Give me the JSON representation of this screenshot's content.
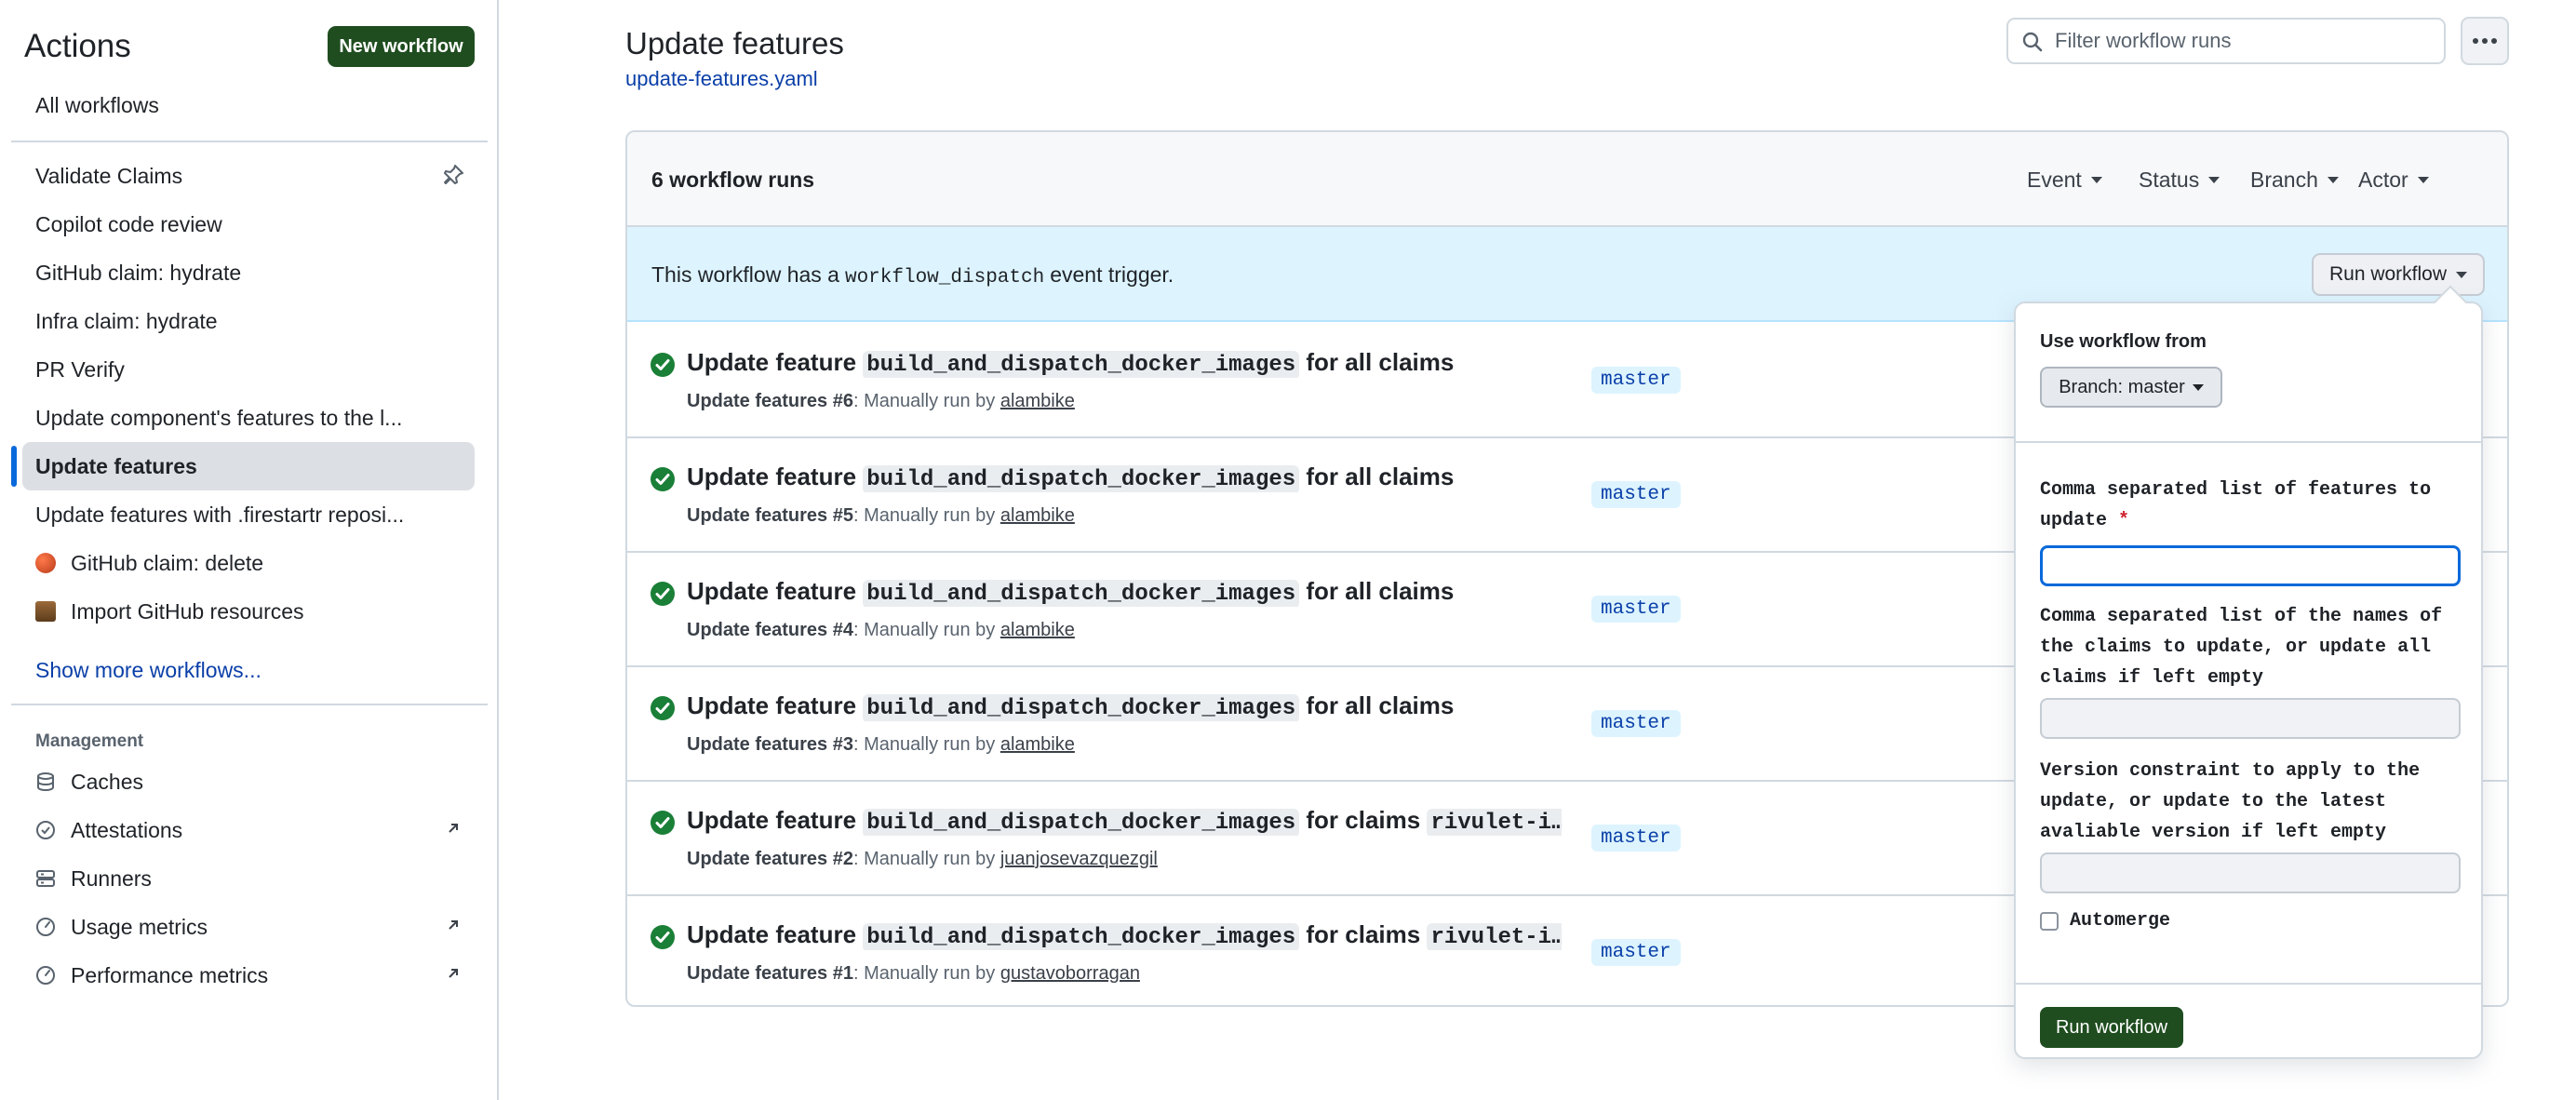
{
  "sidebar": {
    "title": "Actions",
    "new_workflow": "New workflow",
    "all_workflows": "All workflows",
    "workflows": [
      {
        "label": "Validate Claims",
        "pinned": true
      },
      {
        "label": "Copilot code review"
      },
      {
        "label": "GitHub claim: hydrate"
      },
      {
        "label": "Infra claim: hydrate"
      },
      {
        "label": "PR Verify"
      },
      {
        "label": "Update component's features to the l..."
      },
      {
        "label": "Update features",
        "active": true
      },
      {
        "label": "Update features with .firestartr reposi..."
      },
      {
        "label": "GitHub claim: delete",
        "icon": "red-ball-emoji-icon"
      },
      {
        "label": "Import GitHub resources",
        "icon": "scroll-emoji-icon"
      }
    ],
    "show_more": "Show more workflows...",
    "management_heading": "Management",
    "management": [
      {
        "label": "Caches",
        "icon": "database-icon"
      },
      {
        "label": "Attestations",
        "icon": "verified-icon",
        "external": true
      },
      {
        "label": "Runners",
        "icon": "server-icon"
      },
      {
        "label": "Usage metrics",
        "icon": "meter-icon",
        "external": true
      },
      {
        "label": "Performance metrics",
        "icon": "meter-icon",
        "external": true
      }
    ]
  },
  "header": {
    "title": "Update features",
    "file": "update-features.yaml",
    "filter_placeholder": "Filter workflow runs"
  },
  "runs": {
    "count_label": "6 workflow runs",
    "filters": [
      "Event",
      "Status",
      "Branch",
      "Actor"
    ],
    "dispatch": {
      "prefix": "This workflow has a",
      "code": "workflow_dispatch",
      "suffix": "event trigger.",
      "button": "Run workflow"
    },
    "items": [
      {
        "t1": "Update feature",
        "code": "build_and_dispatch_docker_images",
        "t2": "for all claims",
        "code2": "",
        "wf": "Update features",
        "num": "#6",
        "by": ": Manually run by",
        "actor": "alambike",
        "branch": "master"
      },
      {
        "t1": "Update feature",
        "code": "build_and_dispatch_docker_images",
        "t2": "for all claims",
        "code2": "",
        "wf": "Update features",
        "num": "#5",
        "by": ": Manually run by",
        "actor": "alambike",
        "branch": "master"
      },
      {
        "t1": "Update feature",
        "code": "build_and_dispatch_docker_images",
        "t2": "for all claims",
        "code2": "",
        "wf": "Update features",
        "num": "#4",
        "by": ": Manually run by",
        "actor": "alambike",
        "branch": "master"
      },
      {
        "t1": "Update feature",
        "code": "build_and_dispatch_docker_images",
        "t2": "for all claims",
        "code2": "",
        "wf": "Update features",
        "num": "#3",
        "by": ": Manually run by",
        "actor": "alambike",
        "branch": "master"
      },
      {
        "t1": "Update feature",
        "code": "build_and_dispatch_docker_images",
        "t2": "for claims",
        "code2": "rivulet-i…",
        "wf": "Update features",
        "num": "#2",
        "by": ": Manually run by",
        "actor": "juanjosevazquezgil",
        "branch": "master"
      },
      {
        "t1": "Update feature",
        "code": "build_and_dispatch_docker_images",
        "t2": "for claims",
        "code2": "rivulet-i…",
        "wf": "Update features",
        "num": "#1",
        "by": ": Manually run by",
        "actor": "gustavoborragan",
        "branch": "master"
      }
    ]
  },
  "popover": {
    "use_from_label": "Use workflow from",
    "branch_select": "Branch: master",
    "field1_label": "Comma separated list of features to update",
    "field1_required": "*",
    "field1_value": "",
    "field2_label": "Comma separated list of the names of the claims to update, or update all claims if left empty",
    "field2_value": "",
    "field3_label": "Version constraint to apply to the update, or update to the latest avaliable version if left empty",
    "field3_value": "",
    "automerge_label": "Automerge",
    "run_button": "Run workflow"
  }
}
